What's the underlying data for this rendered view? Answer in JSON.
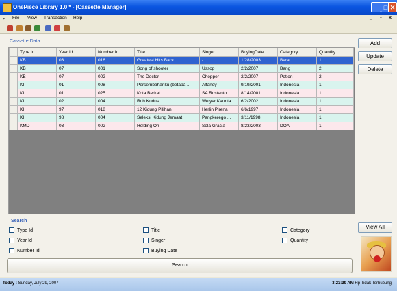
{
  "window": {
    "title": "OnePiece Library 1.0 * - [Cassette Manager]"
  },
  "menu": [
    "File",
    "View",
    "Transaction",
    "Help"
  ],
  "cassette_group_title": "Cassette Data",
  "table": {
    "columns": [
      "Type Id",
      "Year Id",
      "Number Id",
      "Title",
      "Singer",
      "BuyingDate",
      "Category",
      "Quantity"
    ],
    "rows": [
      [
        "KB",
        "03",
        "016",
        "Greatest Hits Back",
        "-",
        "1/28/2003",
        "Barat",
        "1"
      ],
      [
        "KB",
        "07",
        "001",
        "Song of shooter",
        "Ussop",
        "2/2/2007",
        "Bang",
        "2"
      ],
      [
        "KB",
        "07",
        "002",
        "The Doctor",
        "Chopper",
        "2/2/2007",
        "Potion",
        "2"
      ],
      [
        "KI",
        "01",
        "008",
        "Persembahanku (betapa ...",
        "Alfandy",
        "9/19/2001",
        "Indonesia",
        "1"
      ],
      [
        "KI",
        "01",
        "025",
        "Kota Berkat",
        "SA Rostanto",
        "8/14/2001",
        "Indonesia",
        "1"
      ],
      [
        "KI",
        "02",
        "004",
        "Roh Kudus",
        "Welyar Kaunta",
        "6/2/2002",
        "Indonesia",
        "1"
      ],
      [
        "KI",
        "97",
        "018",
        "12 Kidung Pilihan",
        "Herlin Pirena",
        "6/6/1997",
        "Indonesia",
        "1"
      ],
      [
        "KI",
        "98",
        "004",
        "Seleksi Kidung Jemaat",
        "Pangkerego ...",
        "3/11/1998",
        "Indonesia",
        "1"
      ],
      [
        "KMD",
        "03",
        "002",
        "Holding On",
        "Sola Gracia",
        "8/23/2003",
        "DOA",
        "1"
      ]
    ]
  },
  "buttons": {
    "add": "Add",
    "update": "Update",
    "delete": "Delete",
    "view_all": "View All",
    "search": "Search"
  },
  "search": {
    "title": "Search",
    "options": [
      "Type Id",
      "Year Id",
      "Number Id",
      "Title",
      "Singer",
      "Buying Date",
      "Category",
      "Quantity"
    ]
  },
  "status": {
    "left_label": "Today :",
    "date": "Sunday, July 29, 2007",
    "time": "3:23:39 AM",
    "right_text": "Hp Tidak Terhubung"
  },
  "colors": {
    "title_blue": "#0A55E0",
    "selected_row": "#2F63D0",
    "row_alt_1": "#D9F4EE",
    "row_alt_2": "#FCE8EC"
  }
}
